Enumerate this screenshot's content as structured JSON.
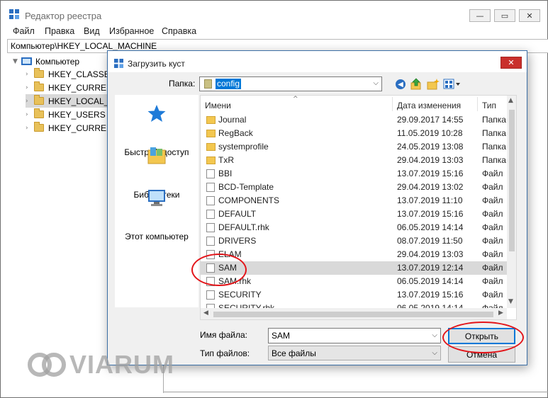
{
  "registry": {
    "title": "Редактор реестра",
    "menu": [
      "Файл",
      "Правка",
      "Вид",
      "Избранное",
      "Справка"
    ],
    "address": "Компьютер\\HKEY_LOCAL_MACHINE",
    "tree": {
      "root": "Компьютер",
      "items": [
        "HKEY_CLASSES_",
        "HKEY_CURRENT",
        "HKEY_LOCAL_M",
        "HKEY_USERS",
        "HKEY_CURRENT"
      ]
    }
  },
  "dialog": {
    "title": "Загрузить куст",
    "folder_label": "Папка:",
    "folder_value": "config",
    "places": [
      "Быстрый доступ",
      "Библиотеки",
      "Этот компьютер"
    ],
    "columns": {
      "name": "Имени",
      "date": "Дата изменения",
      "type": "Тип"
    },
    "files": [
      {
        "name": "Journal",
        "date": "29.09.2017 14:55",
        "type": "Папка",
        "kind": "folder"
      },
      {
        "name": "RegBack",
        "date": "11.05.2019 10:28",
        "type": "Папка",
        "kind": "folder"
      },
      {
        "name": "systemprofile",
        "date": "24.05.2019 13:08",
        "type": "Папка",
        "kind": "folder"
      },
      {
        "name": "TxR",
        "date": "29.04.2019 13:03",
        "type": "Папка",
        "kind": "folder"
      },
      {
        "name": "BBI",
        "date": "13.07.2019 15:16",
        "type": "Файл",
        "kind": "file"
      },
      {
        "name": "BCD-Template",
        "date": "29.04.2019 13:02",
        "type": "Файл",
        "kind": "file"
      },
      {
        "name": "COMPONENTS",
        "date": "13.07.2019 11:10",
        "type": "Файл",
        "kind": "file"
      },
      {
        "name": "DEFAULT",
        "date": "13.07.2019 15:16",
        "type": "Файл",
        "kind": "file"
      },
      {
        "name": "DEFAULT.rhk",
        "date": "06.05.2019 14:14",
        "type": "Файл",
        "kind": "file"
      },
      {
        "name": "DRIVERS",
        "date": "08.07.2019 11:50",
        "type": "Файл",
        "kind": "file"
      },
      {
        "name": "ELAM",
        "date": "29.04.2019 13:03",
        "type": "Файл",
        "kind": "file"
      },
      {
        "name": "SAM",
        "date": "13.07.2019 12:14",
        "type": "Файл",
        "kind": "file",
        "selected": true
      },
      {
        "name": "SAM.rhk",
        "date": "06.05.2019 14:14",
        "type": "Файл",
        "kind": "file"
      },
      {
        "name": "SECURITY",
        "date": "13.07.2019 15:16",
        "type": "Файл",
        "kind": "file"
      },
      {
        "name": "SECURITY.rhk",
        "date": "06.05.2019 14:14",
        "type": "Файл",
        "kind": "file"
      }
    ],
    "filename_label": "Имя файла:",
    "filename_value": "SAM",
    "filetype_label": "Тип файлов:",
    "filetype_value": "Все файлы",
    "open_label": "Открыть",
    "cancel_label": "Отмена"
  },
  "watermark": "VIARUM",
  "colors": {
    "accent": "#0078d7",
    "annotation": "#e3151a",
    "close_button": "#c9302c"
  }
}
